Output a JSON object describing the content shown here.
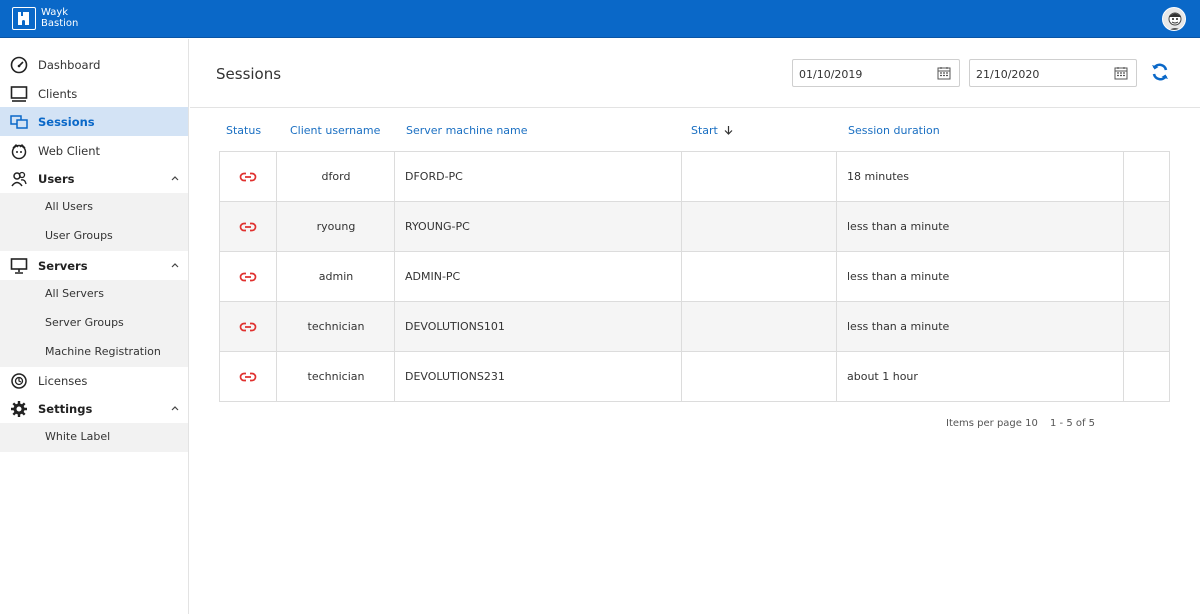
{
  "app": {
    "brand_line1": "Wayk",
    "brand_line2": "Bastion"
  },
  "colors": {
    "topbar": "#0a68c8",
    "accent": "#1a6fc2",
    "active_nav_bg": "#d3e3f5",
    "status_link": "#e0312f"
  },
  "sidebar": {
    "items": [
      {
        "label": "Dashboard",
        "icon": "speedometer-icon"
      },
      {
        "label": "Clients",
        "icon": "monitor-icon"
      },
      {
        "label": "Sessions",
        "icon": "sessions-icon",
        "active": true
      },
      {
        "label": "Web Client",
        "icon": "web-client-icon"
      },
      {
        "label": "Users",
        "icon": "users-icon",
        "expanded": true
      },
      {
        "label": "All Users"
      },
      {
        "label": "User Groups"
      },
      {
        "label": "Servers",
        "icon": "server-monitor-icon",
        "expanded": true
      },
      {
        "label": "All Servers"
      },
      {
        "label": "Server Groups"
      },
      {
        "label": "Machine Registration"
      },
      {
        "label": "Licenses",
        "icon": "license-icon"
      },
      {
        "label": "Settings",
        "icon": "gear-icon",
        "expanded": true
      },
      {
        "label": "White Label"
      }
    ]
  },
  "main": {
    "title": "Sessions",
    "date_from": "01/10/2019",
    "date_to": "21/10/2020",
    "columns": {
      "status": "Status",
      "client_username": "Client username",
      "server_machine_name": "Server machine name",
      "start": "Start",
      "session_duration": "Session duration"
    },
    "rows": [
      {
        "status": "link-icon",
        "client_username": "dford",
        "server_machine_name": "DFORD-PC",
        "start": "",
        "session_duration": "18 minutes"
      },
      {
        "status": "link-icon",
        "client_username": "ryoung",
        "server_machine_name": "RYOUNG-PC",
        "start": "",
        "session_duration": "less than a minute"
      },
      {
        "status": "link-icon",
        "client_username": "admin",
        "server_machine_name": "ADMIN-PC",
        "start": "",
        "session_duration": "less than a minute"
      },
      {
        "status": "link-icon",
        "client_username": "technician",
        "server_machine_name": "DEVOLUTIONS101",
        "start": "",
        "session_duration": "less than a minute"
      },
      {
        "status": "link-icon",
        "client_username": "technician",
        "server_machine_name": "DEVOLUTIONS231",
        "start": "",
        "session_duration": "about 1 hour"
      }
    ],
    "pager": {
      "items_per_page": "Items per page 10",
      "range": "1 - 5 of 5"
    }
  }
}
